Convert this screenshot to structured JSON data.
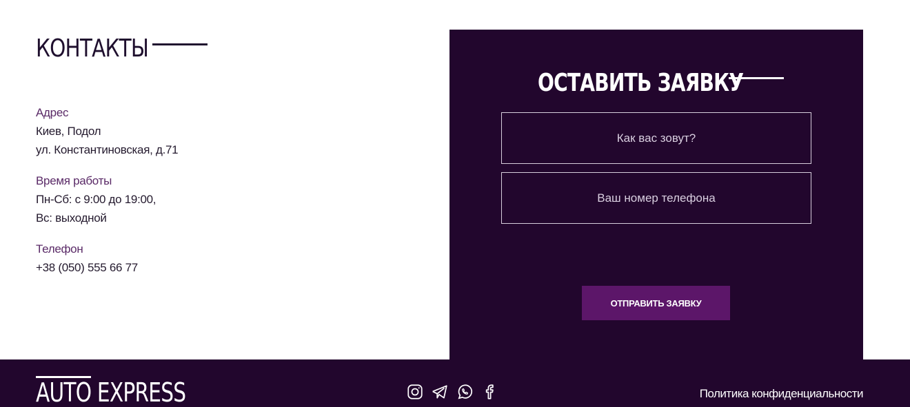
{
  "contacts": {
    "title": "КОНТАКТЫ",
    "address": {
      "label": "Адрес",
      "lines": [
        "Киев, Подол",
        "ул. Константиновская, д.71"
      ]
    },
    "hours": {
      "label": "Время работы",
      "lines": [
        "Пн-Сб: с 9:00 до 19:00,",
        "Вс: выходной"
      ]
    },
    "phone": {
      "label": "Телефон",
      "lines": [
        "+38 (050) 555 66 77"
      ]
    }
  },
  "form": {
    "title": "ОСТАВИТЬ ЗАЯВКУ",
    "name_placeholder": "Как вас зовут?",
    "phone_placeholder": "Ваш номер телефона",
    "submit_label": "ОТПРАВИТЬ ЗАЯВКУ"
  },
  "footer": {
    "logo": "AUTO EXPRESS",
    "socials": [
      "instagram-icon",
      "telegram-icon",
      "whatsapp-icon",
      "facebook-icon"
    ],
    "policy_label": "Политика конфиденциальности"
  },
  "colors": {
    "dark_purple": "#22062d",
    "accent_purple": "#5c1669",
    "label_purple": "#5a2a67"
  }
}
